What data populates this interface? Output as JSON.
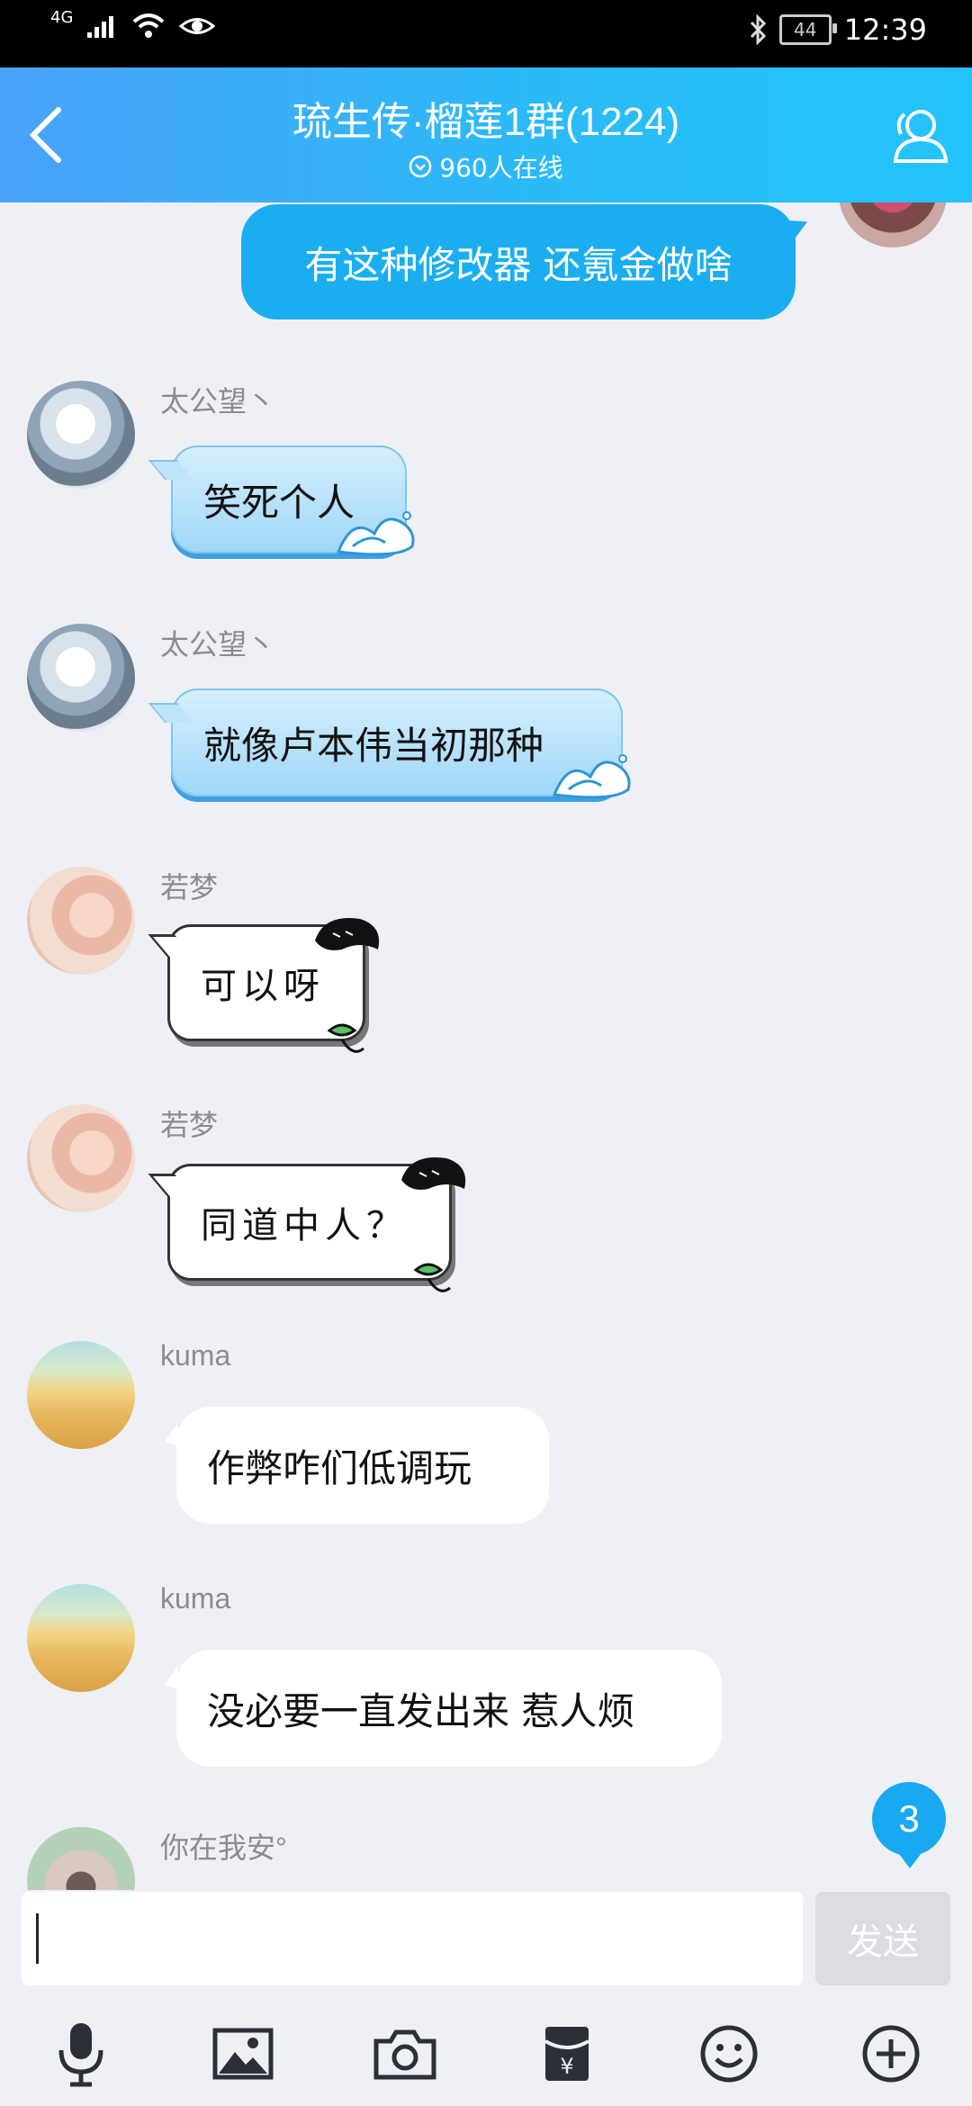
{
  "status_bar": {
    "network": "4G",
    "battery": "44",
    "time": "12:39"
  },
  "header": {
    "title": "琉生传·榴莲1群(1224)",
    "online": "960人在线"
  },
  "messages": [
    {
      "sender": "",
      "text": "有这种修改器  还氪金做啥",
      "mine": true
    },
    {
      "sender": "太公望丶",
      "text": "笑死个人"
    },
    {
      "sender": "太公望丶",
      "text": "就像卢本伟当初那种"
    },
    {
      "sender": "若梦",
      "text": "可以呀"
    },
    {
      "sender": "若梦",
      "text": "同道中人？"
    },
    {
      "sender": "kuma",
      "text": "作弊咋们低调玩"
    },
    {
      "sender": "kuma",
      "text": "没必要一直发出来 惹人烦"
    },
    {
      "sender": "你在我安°",
      "text": ""
    }
  ],
  "unread_count": "3",
  "input": {
    "value": "",
    "send_label": "发送"
  },
  "toolbar": [
    "microphone-icon",
    "image-icon",
    "camera-icon",
    "red-packet-icon",
    "emoji-icon",
    "plus-icon"
  ],
  "colors": {
    "header_start": "#4aa3f9",
    "header_end": "#23c4fb",
    "my_bubble": "#1aaef0",
    "background": "#eff0f5"
  }
}
